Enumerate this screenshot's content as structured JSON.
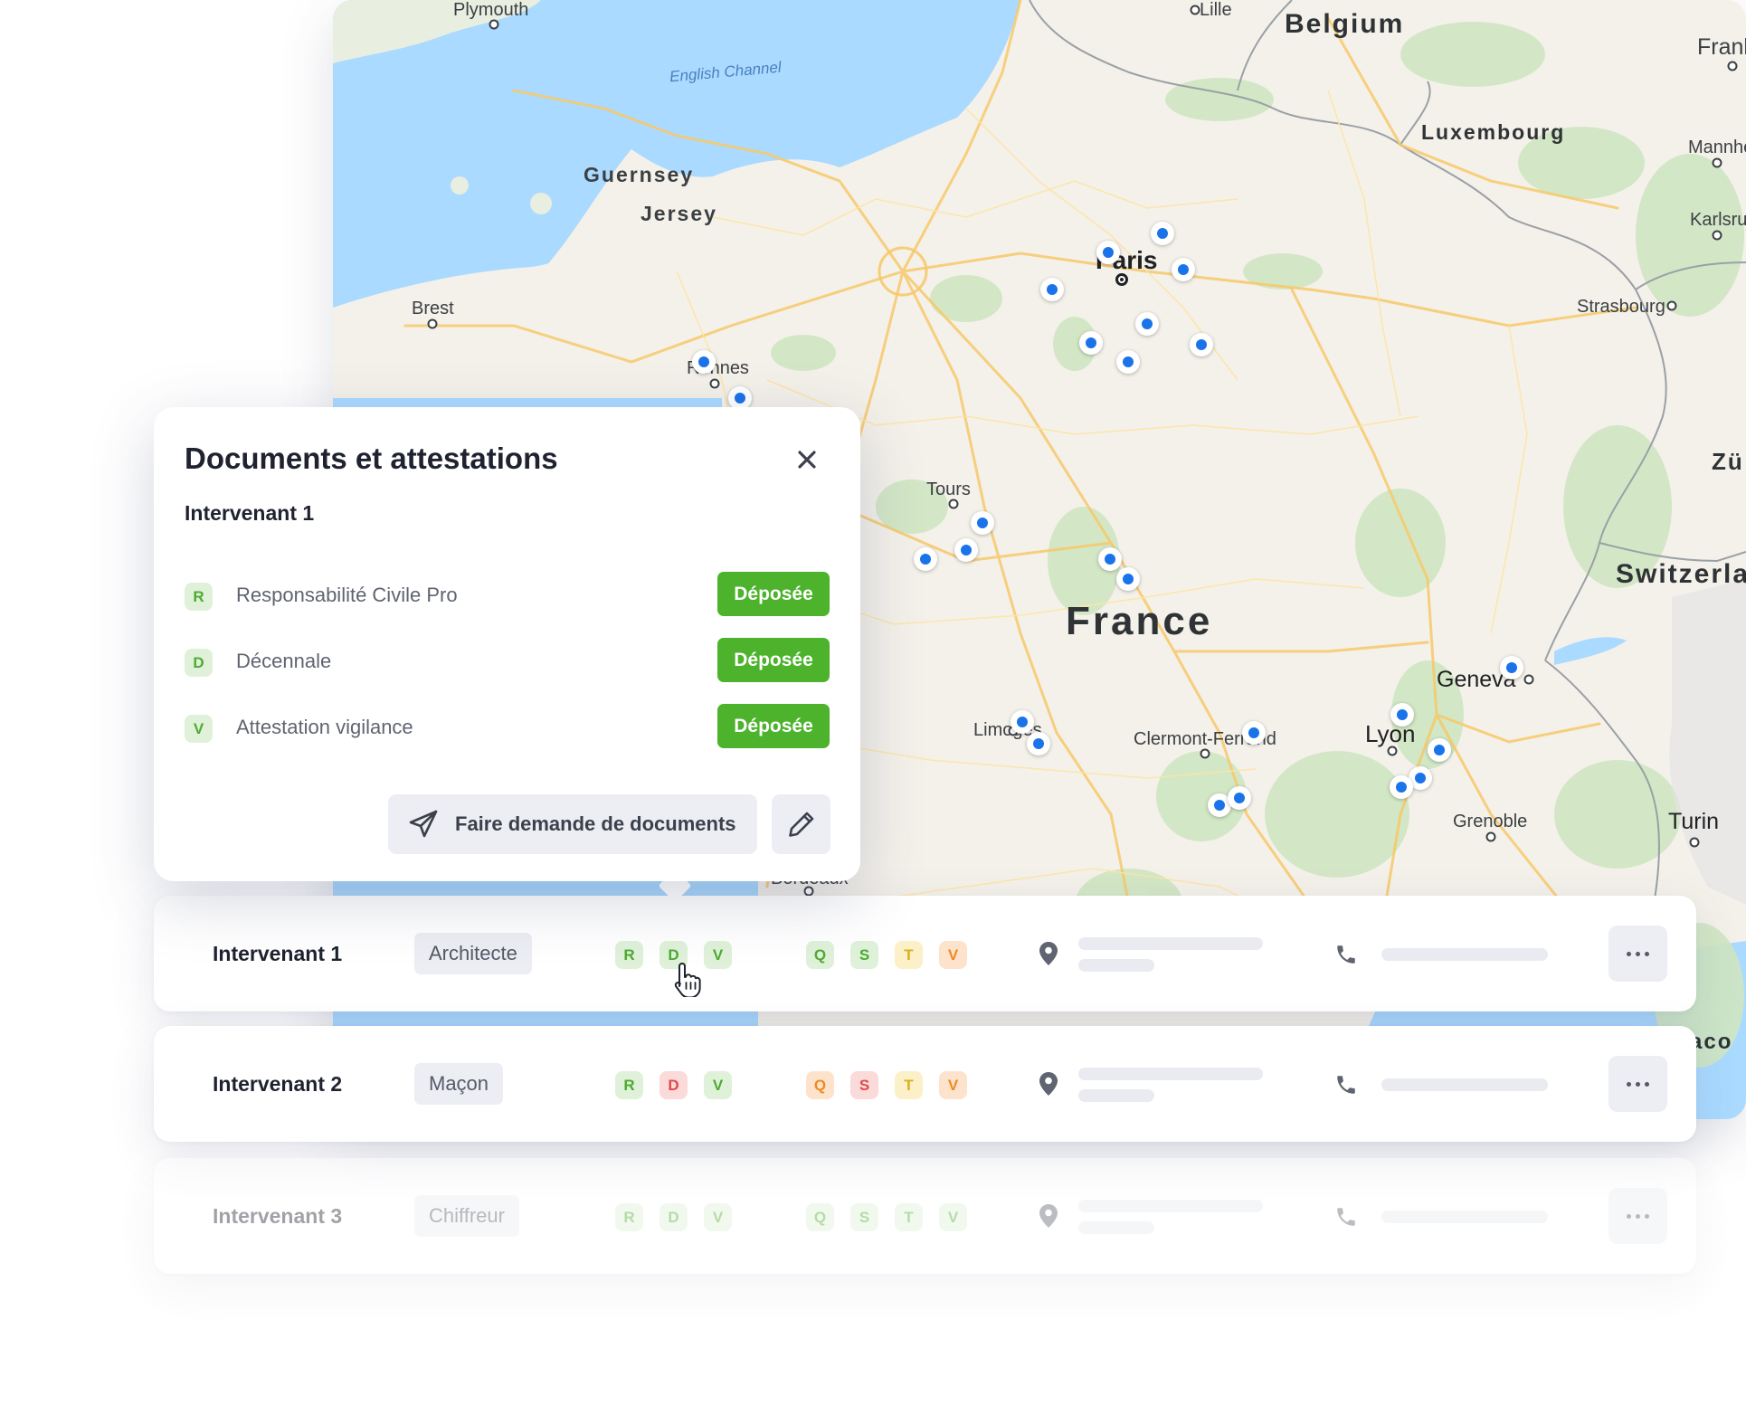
{
  "map": {
    "labels": [
      {
        "id": "plymouth",
        "text": "Plymouth",
        "kind": "city"
      },
      {
        "id": "lille",
        "text": "Lille",
        "kind": "city"
      },
      {
        "id": "belgium",
        "text": "Belgium",
        "kind": "country"
      },
      {
        "id": "frankfurt",
        "text": "Frank",
        "kind": "city"
      },
      {
        "id": "english-channel",
        "text": "English Channel",
        "kind": "sea"
      },
      {
        "id": "luxembourg",
        "text": "Luxembourg",
        "kind": "country"
      },
      {
        "id": "mannheim",
        "text": "Mannhei",
        "kind": "city"
      },
      {
        "id": "guernsey",
        "text": "Guernsey",
        "kind": "island"
      },
      {
        "id": "jersey",
        "text": "Jersey",
        "kind": "island"
      },
      {
        "id": "karlsruhe",
        "text": "Karlsruh",
        "kind": "city"
      },
      {
        "id": "paris",
        "text": "Paris",
        "kind": "capital"
      },
      {
        "id": "brest",
        "text": "Brest",
        "kind": "city"
      },
      {
        "id": "strasbourg",
        "text": "Strasbourg",
        "kind": "city"
      },
      {
        "id": "rennes",
        "text": "Rennes",
        "kind": "city"
      },
      {
        "id": "zurich",
        "text": "Zü",
        "kind": "city"
      },
      {
        "id": "tours",
        "text": "Tours",
        "kind": "city"
      },
      {
        "id": "switzerland",
        "text": "Switzerla",
        "kind": "country"
      },
      {
        "id": "france",
        "text": "France",
        "kind": "country-big"
      },
      {
        "id": "geneva",
        "text": "Geneva",
        "kind": "city"
      },
      {
        "id": "limoges",
        "text": "Limoges",
        "kind": "city"
      },
      {
        "id": "clermont",
        "text": "Clermont-Ferrand",
        "kind": "city"
      },
      {
        "id": "lyon",
        "text": "Lyon",
        "kind": "city"
      },
      {
        "id": "grenoble",
        "text": "Grenoble",
        "kind": "city"
      },
      {
        "id": "turin",
        "text": "Turin",
        "kind": "city"
      },
      {
        "id": "bordeaux",
        "text": "Bordeaux",
        "kind": "city"
      },
      {
        "id": "monaco",
        "text": "aco",
        "kind": "city"
      }
    ],
    "marker_count": 26
  },
  "popup": {
    "title": "Documents et attestations",
    "subtitle": "Intervenant 1",
    "documents": [
      {
        "code": "R",
        "label": "Responsabilité Civile Pro",
        "status": "Déposée"
      },
      {
        "code": "D",
        "label": "Décennale",
        "status": "Déposée"
      },
      {
        "code": "V",
        "label": "Attestation vigilance",
        "status": "Déposée"
      }
    ],
    "request_button": "Faire demande de documents",
    "edit_icon": "pencil-icon",
    "close_icon": "close-icon",
    "status_color": "#4db22c"
  },
  "rows": [
    {
      "name": "Intervenant 1",
      "role": "Architecte",
      "docs": [
        {
          "code": "R",
          "state": "green"
        },
        {
          "code": "D",
          "state": "green"
        },
        {
          "code": "V",
          "state": "green"
        }
      ],
      "quals": [
        {
          "code": "Q",
          "state": "green"
        },
        {
          "code": "S",
          "state": "green"
        },
        {
          "code": "T",
          "state": "yellow"
        },
        {
          "code": "V",
          "state": "orange"
        }
      ]
    },
    {
      "name": "Intervenant 2",
      "role": "Maçon",
      "docs": [
        {
          "code": "R",
          "state": "green"
        },
        {
          "code": "D",
          "state": "red"
        },
        {
          "code": "V",
          "state": "green"
        }
      ],
      "quals": [
        {
          "code": "Q",
          "state": "orange"
        },
        {
          "code": "S",
          "state": "red"
        },
        {
          "code": "T",
          "state": "yellow"
        },
        {
          "code": "V",
          "state": "orange"
        }
      ]
    },
    {
      "name": "Intervenant 3",
      "role": "Chiffreur",
      "docs": [
        {
          "code": "R",
          "state": "green"
        },
        {
          "code": "D",
          "state": "green"
        },
        {
          "code": "V",
          "state": "green"
        }
      ],
      "quals": [
        {
          "code": "Q",
          "state": "green"
        },
        {
          "code": "S",
          "state": "green"
        },
        {
          "code": "T",
          "state": "green"
        },
        {
          "code": "V",
          "state": "green"
        }
      ]
    }
  ],
  "icons": {
    "location": "map-pin-icon",
    "phone": "phone-icon",
    "more": "more-icon",
    "send": "paper-plane-icon",
    "cursor": "hand-pointer-icon"
  },
  "colors": {
    "accent_green": "#4db22c",
    "map_water": "#aadaff",
    "map_land": "#f4f1ea",
    "marker_blue": "#1a73e8"
  }
}
